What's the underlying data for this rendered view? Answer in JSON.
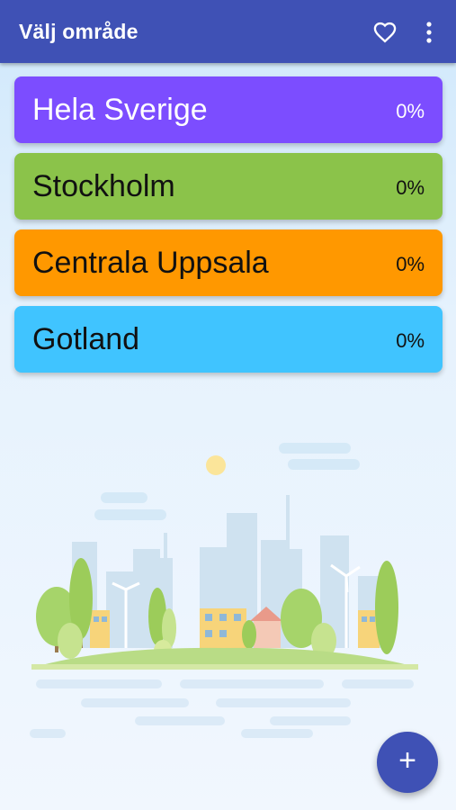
{
  "appbar": {
    "title": "Välj område",
    "favorite_icon": "heart-outline-icon",
    "menu_icon": "more-vertical-icon"
  },
  "areas": [
    {
      "name": "Hela Sverige",
      "percent": "0%",
      "color": "#7c4dff",
      "text_color": "#ffffff"
    },
    {
      "name": "Stockholm",
      "percent": "0%",
      "color": "#8bc34a",
      "text_color": "#111111"
    },
    {
      "name": "Centrala Uppsala",
      "percent": "0%",
      "color": "#ff9800",
      "text_color": "#111111"
    },
    {
      "name": "Gotland",
      "percent": "0%",
      "color": "#40c4ff",
      "text_color": "#111111"
    }
  ],
  "fab": {
    "label": "+",
    "icon": "add-icon"
  },
  "colors": {
    "primary": "#3f51b5"
  }
}
